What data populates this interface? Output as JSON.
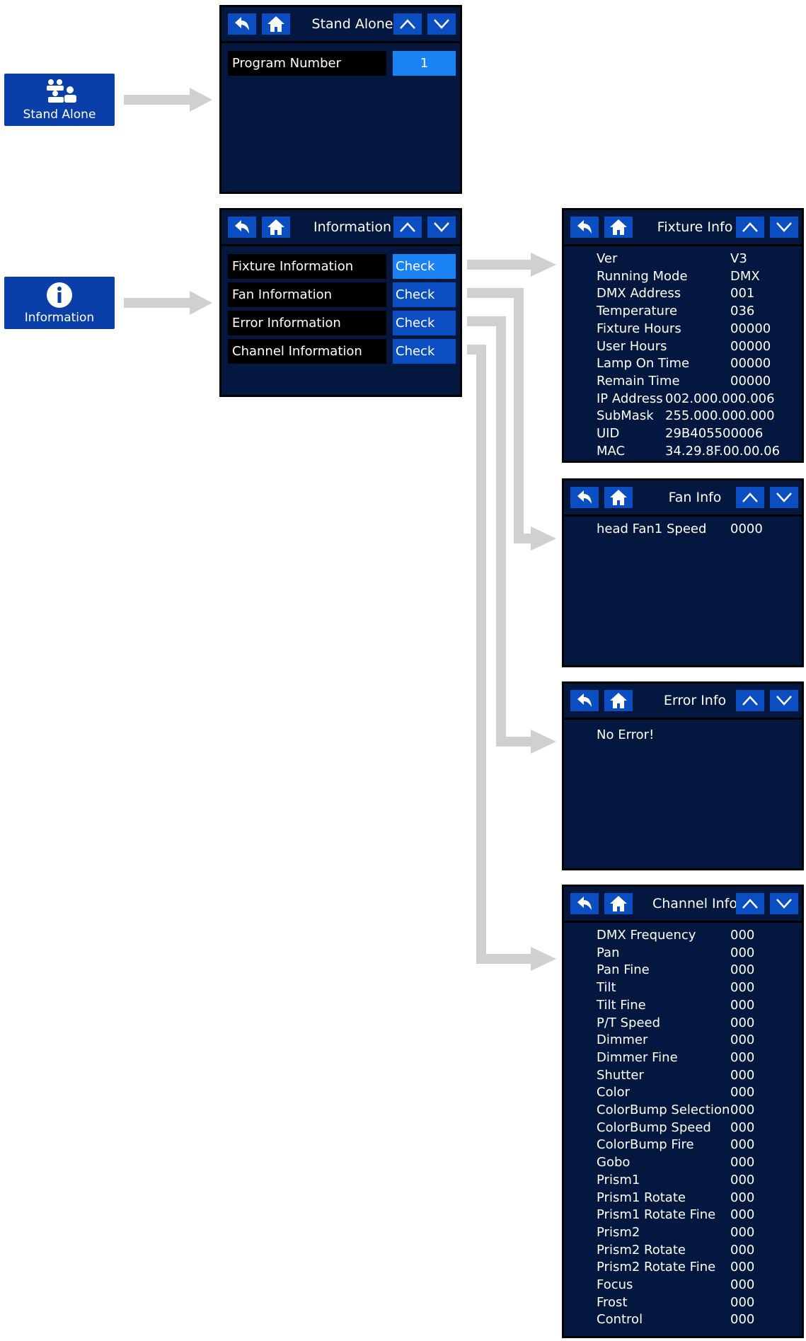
{
  "tiles": {
    "stand_alone": "Stand Alone",
    "information": "Information"
  },
  "stand_alone_panel": {
    "title": "Stand Alone",
    "program_number_label": "Program Number",
    "program_number_value": "1"
  },
  "information_panel": {
    "title": "Information",
    "rows": [
      {
        "label": "Fixture Information",
        "action": "Check"
      },
      {
        "label": "Fan Information",
        "action": "Check"
      },
      {
        "label": "Error Information",
        "action": "Check"
      },
      {
        "label": "Channel Information",
        "action": "Check"
      }
    ]
  },
  "fixture_info": {
    "title": "Fixture Info",
    "items": [
      {
        "label": "Ver",
        "value": "V3"
      },
      {
        "label": "Running Mode",
        "value": "DMX"
      },
      {
        "label": "DMX Address",
        "value": "001"
      },
      {
        "label": "Temperature",
        "value": "036"
      },
      {
        "label": "Fixture Hours",
        "value": "00000"
      },
      {
        "label": "User Hours",
        "value": "00000"
      },
      {
        "label": "Lamp On Time",
        "value": "00000"
      },
      {
        "label": "Remain Time",
        "value": "00000"
      },
      {
        "label": "IP Address",
        "value": "002.000.000.006"
      },
      {
        "label": "SubMask",
        "value": "255.000.000.000"
      },
      {
        "label": "UID",
        "value": "29B405500006"
      },
      {
        "label": "MAC",
        "value": "34.29.8F.00.00.06"
      }
    ]
  },
  "fan_info": {
    "title": "Fan Info",
    "items": [
      {
        "label": "head Fan1 Speed",
        "value": "0000"
      }
    ]
  },
  "error_info": {
    "title": "Error Info",
    "message": "No Error!"
  },
  "channel_info": {
    "title": "Channel Info",
    "items": [
      {
        "label": "DMX Frequency",
        "value": "000"
      },
      {
        "label": "Pan",
        "value": "000"
      },
      {
        "label": "Pan Fine",
        "value": "000"
      },
      {
        "label": "Tilt",
        "value": "000"
      },
      {
        "label": "Tilt Fine",
        "value": "000"
      },
      {
        "label": "P/T Speed",
        "value": "000"
      },
      {
        "label": "Dimmer",
        "value": "000"
      },
      {
        "label": "Dimmer Fine",
        "value": "000"
      },
      {
        "label": "Shutter",
        "value": "000"
      },
      {
        "label": "Color",
        "value": "000"
      },
      {
        "label": "ColorBump Selection",
        "value": "000"
      },
      {
        "label": "ColorBump Speed",
        "value": "000"
      },
      {
        "label": "ColorBump Fire",
        "value": "000"
      },
      {
        "label": "Gobo",
        "value": "000"
      },
      {
        "label": "Prism1",
        "value": "000"
      },
      {
        "label": "Prism1 Rotate",
        "value": "000"
      },
      {
        "label": "Prism1 Rotate Fine",
        "value": "000"
      },
      {
        "label": "Prism2",
        "value": "000"
      },
      {
        "label": "Prism2 Rotate",
        "value": "000"
      },
      {
        "label": "Prism2 Rotate Fine",
        "value": "000"
      },
      {
        "label": "Focus",
        "value": "000"
      },
      {
        "label": "Frost",
        "value": "000"
      },
      {
        "label": "Control",
        "value": "000"
      }
    ]
  },
  "colors": {
    "panel_bg": "#03173f",
    "button_blue": "#0b4ec2",
    "active_blue": "#1a82f2",
    "tile_blue": "#0a3ea8",
    "arrow_gray": "#d0d0d0"
  },
  "icons": [
    "back-arrow-icon",
    "home-icon",
    "chevron-up-icon",
    "chevron-down-icon",
    "users-group-icon",
    "info-circle-icon"
  ]
}
